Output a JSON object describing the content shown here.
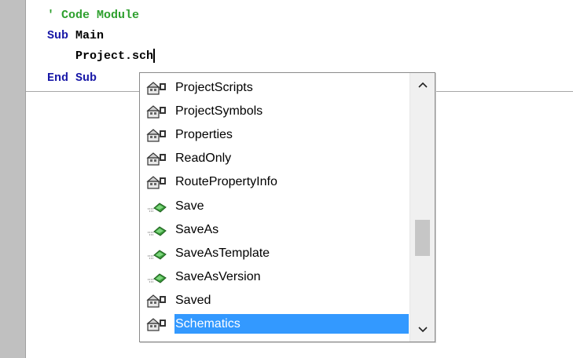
{
  "code": {
    "line1": "' Code Module",
    "line2_kw": "Sub",
    "line2_rest": " Main",
    "line3": "    Project.sch",
    "line4_kw1": "End",
    "line4_kw2": "Sub"
  },
  "completion": {
    "items": [
      {
        "label": "ProjectScripts",
        "icon": "property-icon"
      },
      {
        "label": "ProjectSymbols",
        "icon": "property-icon"
      },
      {
        "label": "Properties",
        "icon": "property-icon"
      },
      {
        "label": "ReadOnly",
        "icon": "property-icon"
      },
      {
        "label": "RoutePropertyInfo",
        "icon": "property-icon"
      },
      {
        "label": "Save",
        "icon": "method-icon"
      },
      {
        "label": "SaveAs",
        "icon": "method-icon"
      },
      {
        "label": "SaveAsTemplate",
        "icon": "method-icon"
      },
      {
        "label": "SaveAsVersion",
        "icon": "method-icon"
      },
      {
        "label": "Saved",
        "icon": "property-icon"
      },
      {
        "label": "Schematics",
        "icon": "property-icon"
      }
    ],
    "selected_index": 10,
    "colors": {
      "selection": "#3399ff",
      "comment": "#2ea02e",
      "keyword": "#1a1aa8"
    }
  }
}
